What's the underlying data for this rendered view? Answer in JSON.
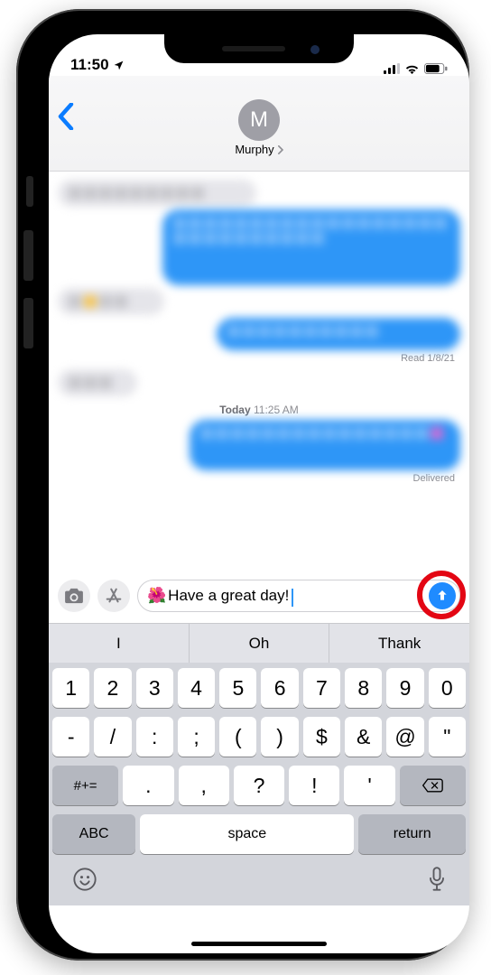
{
  "status": {
    "time": "11:50"
  },
  "header": {
    "contact_name": "Murphy",
    "avatar_letter": "M"
  },
  "conversation": {
    "read_label": "Read 1/8/21",
    "today_label_bold": "Today",
    "today_label_time": "11:25 AM",
    "delivered_label": "Delivered"
  },
  "compose": {
    "emoji": "🌺",
    "text": "Have a great day!"
  },
  "predictions": [
    "I",
    "Oh",
    "Thank"
  ],
  "keyboard": {
    "row1": [
      "1",
      "2",
      "3",
      "4",
      "5",
      "6",
      "7",
      "8",
      "9",
      "0"
    ],
    "row2": [
      "-",
      "/",
      ":",
      ";",
      "(",
      ")",
      "$",
      "&",
      "@",
      "\""
    ],
    "row3_sym": "#+=",
    "row3": [
      ".",
      ",",
      "?",
      "!",
      "'"
    ],
    "abc": "ABC",
    "space": "space",
    "return": "return"
  }
}
